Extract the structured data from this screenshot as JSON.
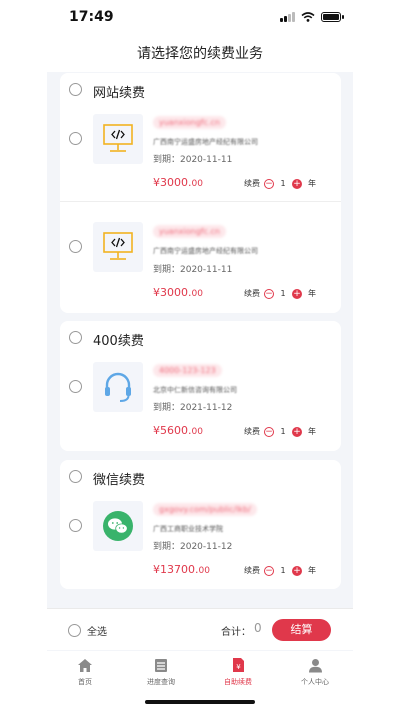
{
  "status_bar": {
    "time": "17:49"
  },
  "header": {
    "title": "请选择您的续费业务"
  },
  "sections": [
    {
      "title": "网站续费",
      "items": [
        {
          "domain": "yuanxiongfc.cn",
          "company": "广西南宁运盛房地产经纪有限公司",
          "expire": "到期：2020-11-11",
          "price_main": "¥3000.",
          "price_cents": "00",
          "renew_label": "续费",
          "qty": "1",
          "unit": "年",
          "icon": "code-monitor-icon"
        },
        {
          "domain": "yuanxiongfc.cn",
          "company": "广西南宁运盛房地产经纪有限公司",
          "expire": "到期：2020-11-11",
          "price_main": "¥3000.",
          "price_cents": "00",
          "renew_label": "续费",
          "qty": "1",
          "unit": "年",
          "icon": "code-monitor-icon"
        }
      ]
    },
    {
      "title": "400续费",
      "items": [
        {
          "domain": "4000-123-123",
          "company": "北京中仁新信咨询有限公司",
          "expire": "到期：2021-11-12",
          "price_main": "¥5600.",
          "price_cents": "00",
          "renew_label": "续费",
          "qty": "1",
          "unit": "年",
          "icon": "headset-icon"
        }
      ]
    },
    {
      "title": "微信续费",
      "items": [
        {
          "domain": "gxgovy.com/public/lkb/",
          "company": "广西工商职业技术学院",
          "expire": "到期：2020-11-12",
          "price_main": "¥13700.",
          "price_cents": "00",
          "renew_label": "续费",
          "qty": "1",
          "unit": "年",
          "icon": "wechat-icon"
        }
      ]
    }
  ],
  "checkout": {
    "select_all": "全选",
    "total_label": "合计：",
    "total_value": "0",
    "settle": "结算"
  },
  "tabs": [
    {
      "label": "首页",
      "icon": "home-icon"
    },
    {
      "label": "进度查询",
      "icon": "progress-icon"
    },
    {
      "label": "自助续费",
      "icon": "renew-icon"
    },
    {
      "label": "个人中心",
      "icon": "user-icon"
    }
  ],
  "colors": {
    "accent": "#e0384b",
    "background": "#f3f5f9",
    "icon_yellow": "#f2b320",
    "wechat_green": "#39b36b",
    "headset_blue": "#5ea7e6"
  }
}
